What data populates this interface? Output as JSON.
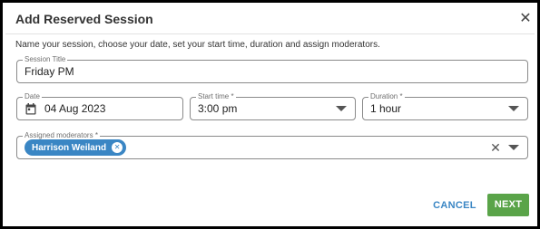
{
  "dialog": {
    "title": "Add Reserved Session",
    "close_icon": "close-icon",
    "instructions": "Name your session, choose your date, set your start time, duration and assign moderators."
  },
  "form": {
    "session_title": {
      "label": "Session Title",
      "value": "Friday PM"
    },
    "date": {
      "label": "Date",
      "value": "04 Aug 2023",
      "icon": "calendar-icon"
    },
    "start_time": {
      "label": "Start time *",
      "value": "3:00 pm"
    },
    "duration": {
      "label": "Duration *",
      "value": "1 hour"
    },
    "moderators": {
      "label": "Assigned moderators *",
      "selected": [
        {
          "name": "Harrison Weiland"
        }
      ]
    }
  },
  "actions": {
    "cancel_label": "CANCEL",
    "next_label": "NEXT"
  },
  "colors": {
    "accent": "#3a86c4",
    "primary_button": "#5aa449"
  }
}
